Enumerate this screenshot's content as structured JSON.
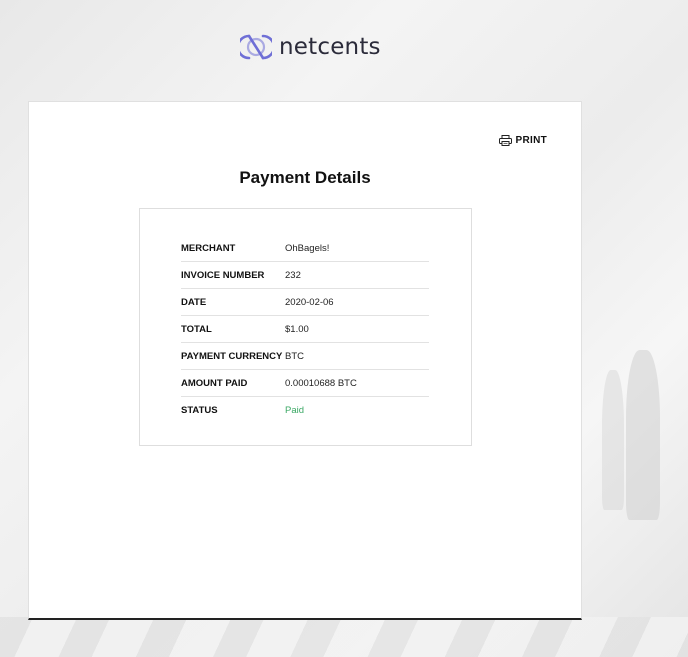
{
  "brand": {
    "name": "netcents"
  },
  "toolbar": {
    "print_label": "PRINT"
  },
  "page": {
    "title": "Payment Details"
  },
  "details": [
    {
      "label": "MERCHANT",
      "value": "OhBagels!"
    },
    {
      "label": "INVOICE NUMBER",
      "value": "232"
    },
    {
      "label": "DATE",
      "value": "2020-02-06"
    },
    {
      "label": "TOTAL",
      "value": "$1.00"
    },
    {
      "label": "PAYMENT CURRENCY",
      "value": "BTC"
    },
    {
      "label": "AMOUNT PAID",
      "value": "0.00010688 BTC"
    },
    {
      "label": "STATUS",
      "value": "Paid"
    }
  ],
  "colors": {
    "brand_accent": "#6f6fd6",
    "status_paid": "#3aa864",
    "text": "#111111"
  },
  "icons": {
    "logo": "netcents-logo-icon",
    "print": "printer-icon"
  }
}
